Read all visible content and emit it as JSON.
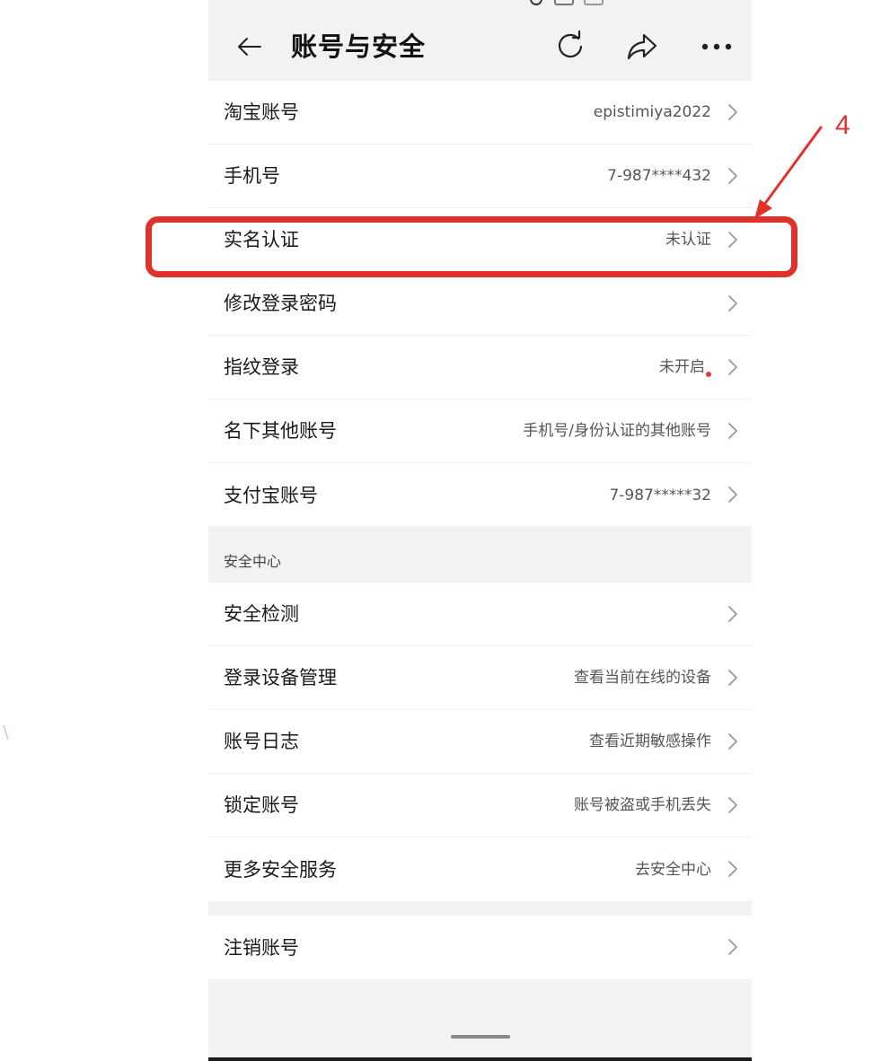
{
  "header": {
    "title": "账号与安全",
    "back_icon": "back-arrow-icon",
    "refresh_icon": "refresh-icon",
    "share_icon": "share-icon",
    "more_icon": "more-dots-icon"
  },
  "account_group": {
    "rows": [
      {
        "label": "淘宝账号",
        "value": "epistimiya2022"
      },
      {
        "label": "手机号",
        "value": "7-987****432"
      },
      {
        "label": "实名认证",
        "value": "未认证"
      },
      {
        "label": "修改登录密码",
        "value": ""
      },
      {
        "label": "指纹登录",
        "value": "未开启"
      },
      {
        "label": "名下其他账号",
        "value": "手机号/身份认证的其他账号"
      },
      {
        "label": "支付宝账号",
        "value": "7-987*****32"
      }
    ]
  },
  "security_section": {
    "title": "安全中心",
    "rows": [
      {
        "label": "安全检测",
        "value": ""
      },
      {
        "label": "登录设备管理",
        "value": "查看当前在线的设备"
      },
      {
        "label": "账号日志",
        "value": "查看近期敏感操作"
      },
      {
        "label": "锁定账号",
        "value": "账号被盗或手机丢失"
      },
      {
        "label": "更多安全服务",
        "value": "去安全中心"
      }
    ]
  },
  "cancel_group": {
    "rows": [
      {
        "label": "注销账号",
        "value": ""
      }
    ]
  },
  "annotation": {
    "number": "4",
    "color": "#e0322a"
  },
  "colors": {
    "background": "#f2f2f2",
    "card": "#ffffff",
    "text": "#1a1a1a",
    "secondary_text": "#555555",
    "chevron": "#999999",
    "notification_dot": "#e53935"
  }
}
